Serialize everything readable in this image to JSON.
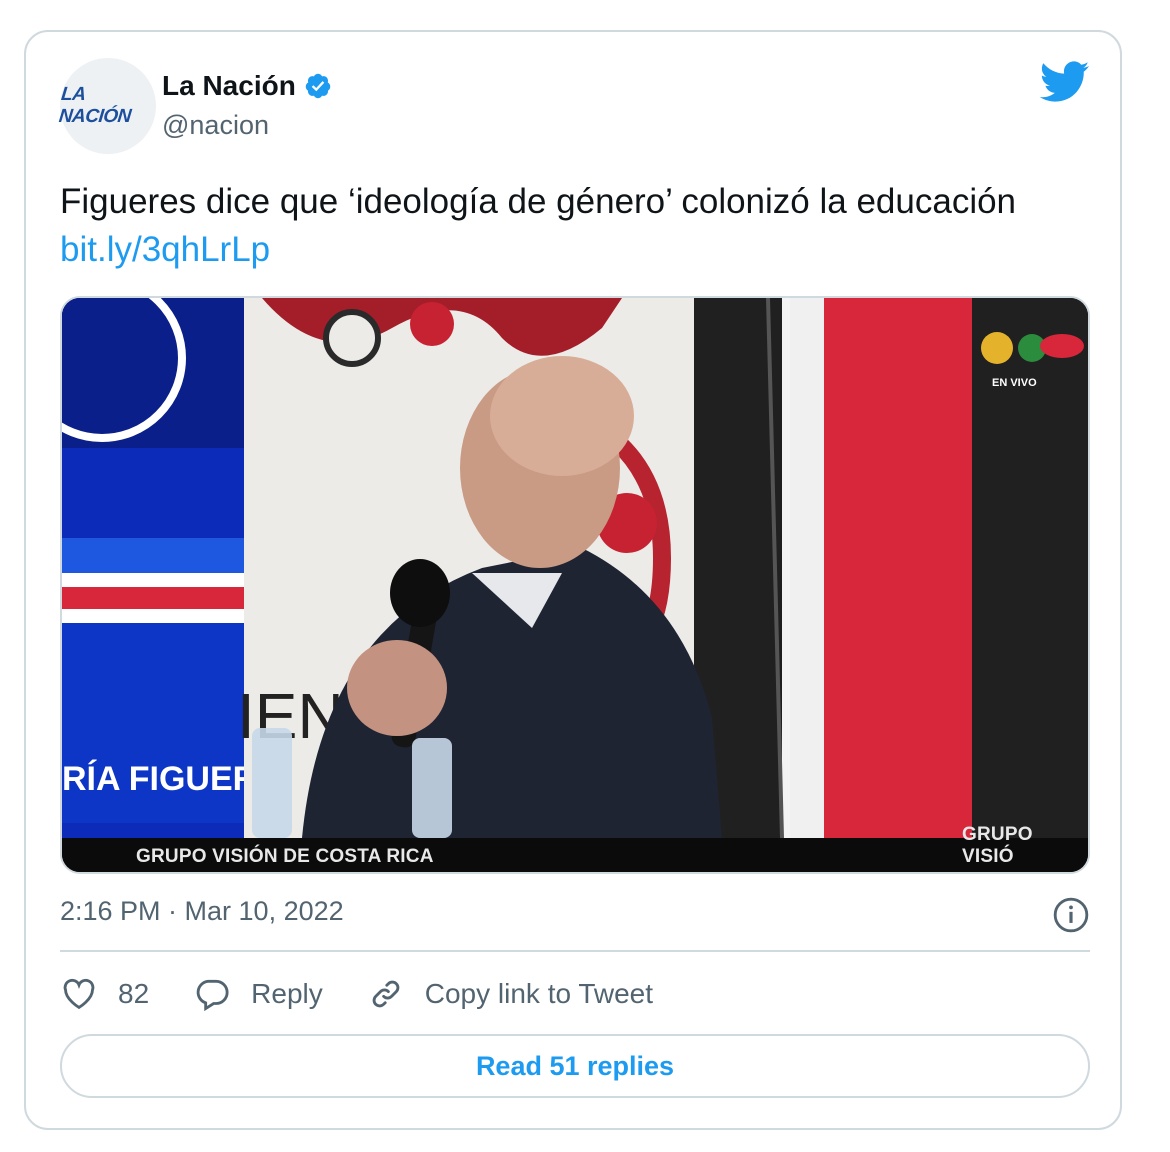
{
  "author": {
    "logo_text": "LA NACIÓN",
    "display_name": "La Nación",
    "handle": "@nacion",
    "verified": true
  },
  "tweet": {
    "text": "Figueres dice que ‘ideología de género’ colonizó la educación ",
    "link_text": "bit.ly/3qhLrLp",
    "timestamp": "2:16 PM · Mar 10, 2022"
  },
  "media": {
    "caption_left": "GRUPO VISIÓN DE COSTA RICA",
    "caption_right": "GRUPO VISIÓ",
    "live_badge": "EN VIVO",
    "name_banner": "RÍA FIGUERES",
    "backdrop_text": "IENT"
  },
  "actions": {
    "like_count": "82",
    "reply_label": "Reply",
    "copy_link_label": "Copy link to Tweet"
  },
  "read_replies_label": "Read 51 replies",
  "colors": {
    "accent": "#1d9bf0",
    "text": "#0f1419",
    "secondary": "#536471",
    "border": "#cfd9de"
  },
  "icons": [
    "verified-badge-icon",
    "twitter-bird-icon",
    "info-icon",
    "heart-icon",
    "reply-bubble-icon",
    "link-icon"
  ]
}
